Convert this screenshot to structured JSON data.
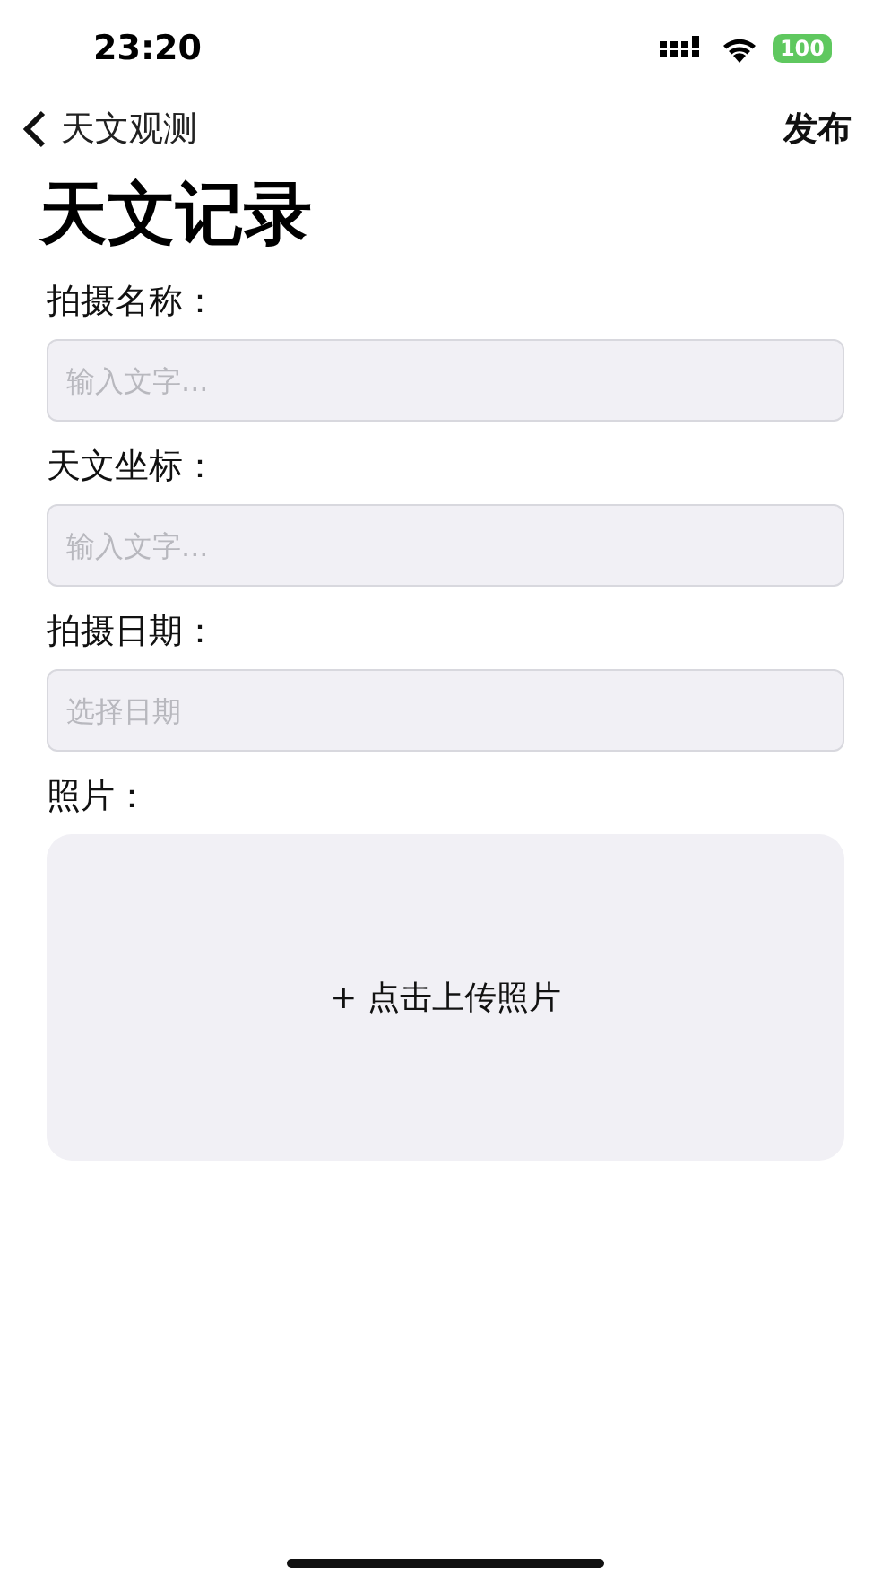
{
  "status_bar": {
    "time": "23:20",
    "battery": "100"
  },
  "nav": {
    "back": "天文观测",
    "action": "发布"
  },
  "title": "天文记录",
  "fields": [
    {
      "kind": "text",
      "label": "拍摄名称：",
      "placeholder": "输入文字..."
    },
    {
      "kind": "text",
      "label": "天文坐标：",
      "placeholder": "输入文字..."
    },
    {
      "kind": "date",
      "label": "拍摄日期：",
      "placeholder": "选择日期"
    },
    {
      "kind": "upload",
      "label": "照片：",
      "prompt": "+ 点击上传照片"
    }
  ]
}
